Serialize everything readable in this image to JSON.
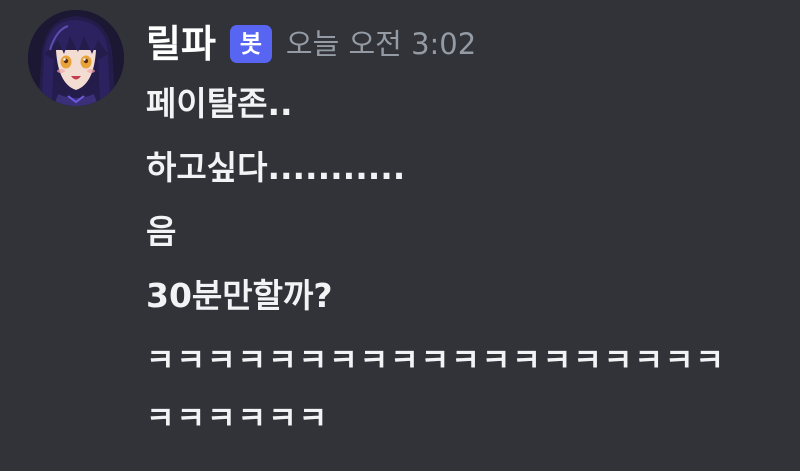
{
  "message": {
    "author": {
      "name": "릴파",
      "badge": "봇",
      "avatar_icon": "anime-character-avatar"
    },
    "timestamp": "오늘 오전 3:02",
    "lines": [
      "페이탈존..",
      "하고싶다...........",
      "음",
      "30분만할까?",
      "ㅋㅋㅋㅋㅋㅋㅋㅋㅋㅋㅋㅋㅋㅋㅋㅋㅋㅋㅋㅋㅋㅋㅋㅋㅋ"
    ]
  },
  "colors": {
    "background": "#313338",
    "text": "#f2f3f5",
    "timestamp": "#949ba4",
    "badge": "#5865f2"
  }
}
